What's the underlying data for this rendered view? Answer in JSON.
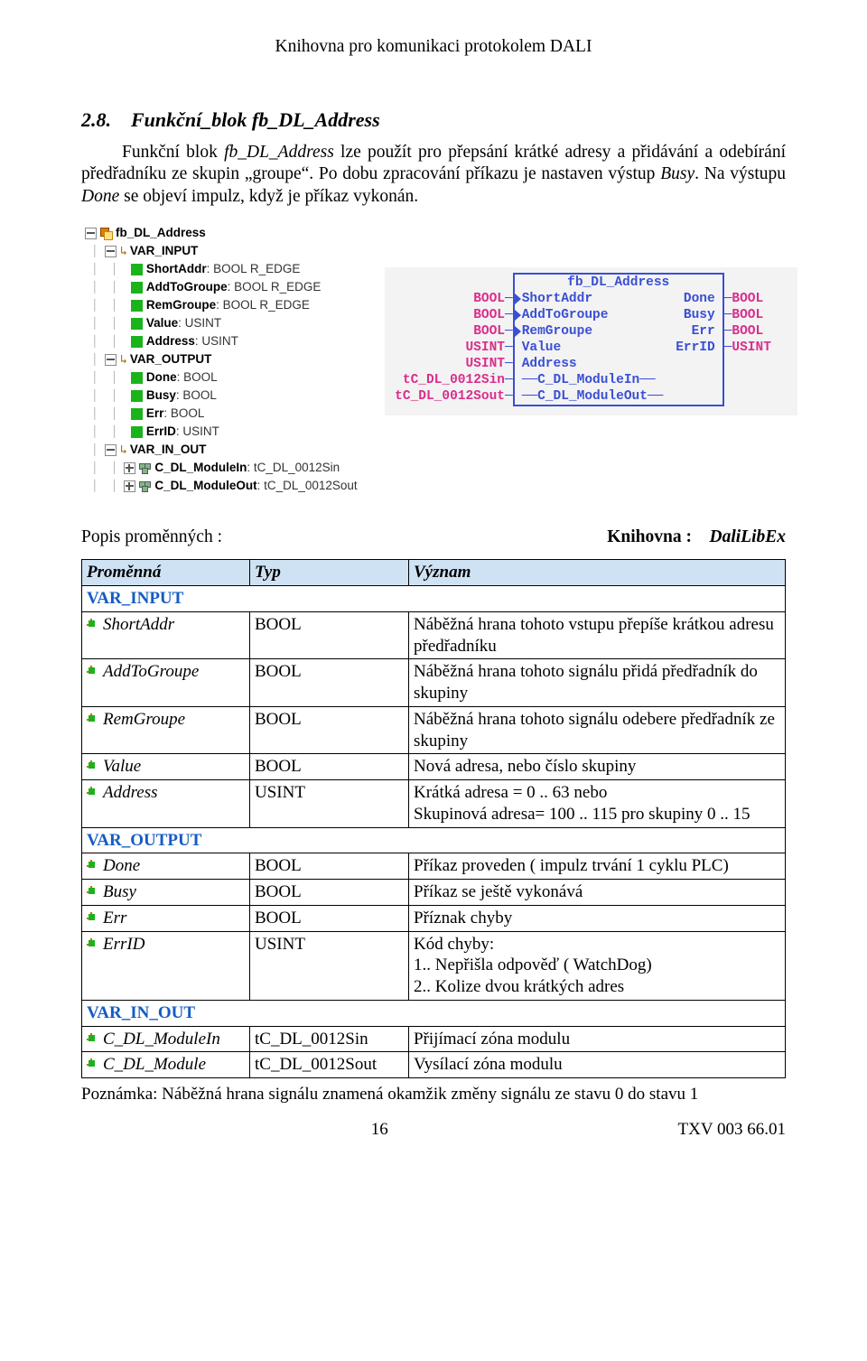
{
  "header": {
    "title": "Knihovna  pro komunikaci protokolem DALI"
  },
  "section": {
    "number": "2.8.",
    "name": "Funkční_blok fb_DL_Address",
    "body_html": "Funkční blok fb_DL_Address lze použít pro přepsání krátké adresy a přidávání a odebírání předřadníku ze skupin „groupe“. Po dobu zpracování příkazu je nastaven výstup Busy. Na výstupu Done se objeví impulz, když je příkaz vykonán."
  },
  "tree": {
    "root": "fb_DL_Address",
    "groups": [
      {
        "name": "VAR_INPUT",
        "expanded": true,
        "items": [
          {
            "name": "ShortAddr",
            "type": "BOOL R_EDGE",
            "icon": "grn"
          },
          {
            "name": "AddToGroupe",
            "type": "BOOL R_EDGE",
            "icon": "grn"
          },
          {
            "name": "RemGroupe",
            "type": "BOOL R_EDGE",
            "icon": "grn"
          },
          {
            "name": "Value",
            "type": "USINT",
            "icon": "grn"
          },
          {
            "name": "Address",
            "type": "USINT",
            "icon": "grn"
          }
        ]
      },
      {
        "name": "VAR_OUTPUT",
        "expanded": true,
        "items": [
          {
            "name": "Done",
            "type": "BOOL",
            "icon": "grn"
          },
          {
            "name": "Busy",
            "type": "BOOL",
            "icon": "grn"
          },
          {
            "name": "Err",
            "type": "BOOL",
            "icon": "grn"
          },
          {
            "name": "ErrID",
            "type": "USINT",
            "icon": "grn"
          }
        ]
      },
      {
        "name": "VAR_IN_OUT",
        "expanded": true,
        "items": [
          {
            "name": "C_DL_ModuleIn",
            "type": "tC_DL_0012Sin",
            "icon": "struct",
            "expandable": true
          },
          {
            "name": "C_DL_ModuleOut",
            "type": "tC_DL_0012Sout",
            "icon": "struct",
            "expandable": true
          }
        ]
      }
    ]
  },
  "fbblock": {
    "title": "fb_DL_Address",
    "rows": [
      {
        "ltype": "BOOL",
        "lname": "ShortAddr",
        "ledge": true,
        "rname": "Done",
        "rtype": "BOOL"
      },
      {
        "ltype": "BOOL",
        "lname": "AddToGroupe",
        "ledge": true,
        "rname": "Busy",
        "rtype": "BOOL"
      },
      {
        "ltype": "BOOL",
        "lname": "RemGroupe",
        "ledge": true,
        "rname": "Err",
        "rtype": "BOOL"
      },
      {
        "ltype": "USINT",
        "lname": "Value",
        "ledge": false,
        "rname": "ErrID",
        "rtype": "USINT"
      },
      {
        "ltype": "USINT",
        "lname": "Address",
        "ledge": false,
        "rname": "",
        "rtype": ""
      }
    ],
    "bus": [
      {
        "ltype": "tC_DL_0012Sin",
        "name": "C_DL_ModuleIn"
      },
      {
        "ltype": "tC_DL_0012Sout",
        "name": "C_DL_ModuleOut"
      }
    ]
  },
  "lib": {
    "label": "Knihovna :",
    "value": "DaliLibEx",
    "left": "Popis proměnných :"
  },
  "table": {
    "headers": [
      "Proměnná",
      "Typ",
      "Význam"
    ],
    "rows": [
      {
        "section": "VAR_INPUT"
      },
      {
        "var": "ShortAddr",
        "type": "BOOL",
        "desc": "Náběžná hrana tohoto vstupu přepíše krátkou adresu předřadníku"
      },
      {
        "var": "AddToGroupe",
        "type": "BOOL",
        "desc": "Náběžná hrana tohoto signálu přidá předřadník do skupi­ny"
      },
      {
        "var": "RemGroupe",
        "type": "BOOL",
        "desc": "Náběžná hrana tohoto signálu odebere předřadník ze sku­piny"
      },
      {
        "var": "Value",
        "type": "BOOL",
        "desc": "Nová adresa, nebo číslo skupiny"
      },
      {
        "var": "Address",
        "type": "USINT",
        "desc": "Krátká adresa = 0 .. 63 nebo\nSkupinová adresa= 100 .. 115 pro skupiny 0 .. 15"
      },
      {
        "section": "VAR_OUTPUT"
      },
      {
        "var": "Done",
        "type": "BOOL",
        "desc": "Příkaz proveden ( impulz trvání 1 cyklu PLC)"
      },
      {
        "var": "Busy",
        "type": "BOOL",
        "desc": "Příkaz se ještě vykonává"
      },
      {
        "var": "Err",
        "type": "BOOL",
        "desc": "Příznak chyby"
      },
      {
        "var": "ErrID",
        "type": "USINT",
        "desc": "Kód chyby:\n1.. Nepřišla odpověď ( WatchDog)\n2.. Kolize dvou krátkých adres"
      },
      {
        "section": "VAR_IN_OUT"
      },
      {
        "var": "C_DL_ModuleIn",
        "type": "tC_DL_0012Sin",
        "desc": "Přijímací zóna modulu"
      },
      {
        "var": "C_DL_Module",
        "type": "tC_DL_0012Sout",
        "desc": "Vysílací zóna modulu"
      }
    ]
  },
  "footnote": "Poznámka: Náběžná hrana signálu znamená okamžik změny signálu ze stavu 0 do stavu 1",
  "footer": {
    "page": "16",
    "doc": "TXV 003 66.01"
  }
}
